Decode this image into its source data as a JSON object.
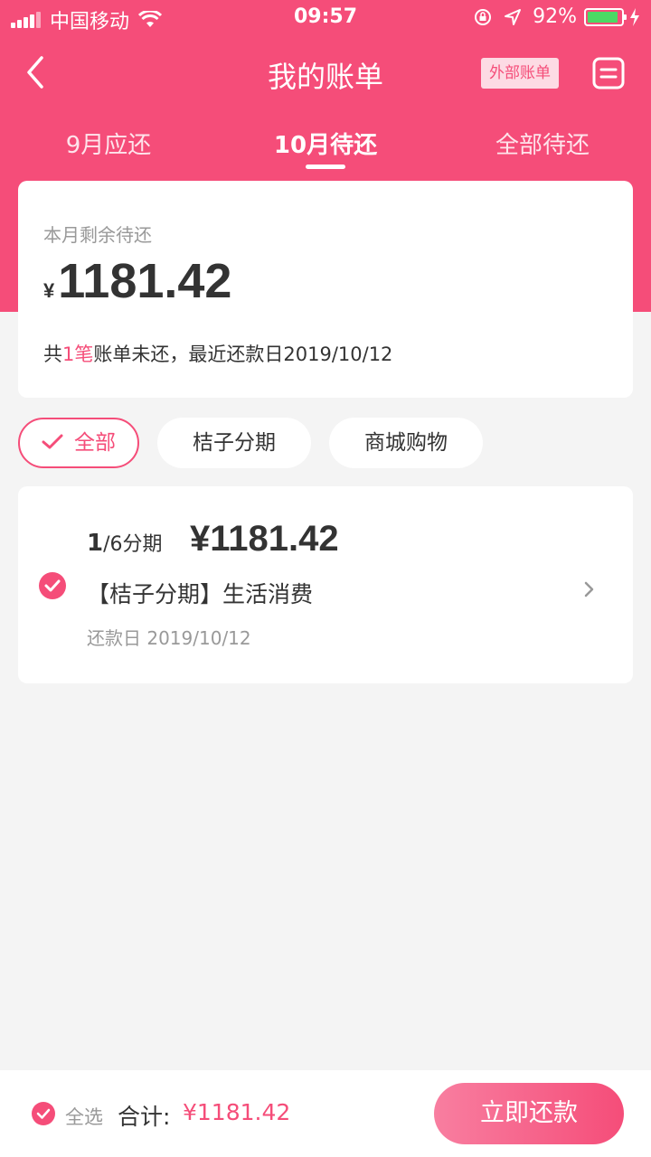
{
  "status_bar": {
    "carrier": "中国移动",
    "time": "09:57",
    "battery": "92%",
    "battery_level": 0.92
  },
  "nav": {
    "title": "我的账单",
    "external_bill": "外部账单"
  },
  "tabs": [
    {
      "label": "9月应还"
    },
    {
      "label": "10月待还"
    },
    {
      "label": "全部待还"
    }
  ],
  "summary": {
    "label": "本月剩余待还",
    "currency": "¥",
    "amount": "1181.42",
    "note_prefix": "共",
    "note_count": "1笔",
    "note_suffix": "账单未还，最近还款日2019/10/12"
  },
  "filters": [
    {
      "label": "全部"
    },
    {
      "label": "桔子分期"
    },
    {
      "label": "商城购物"
    }
  ],
  "bill": {
    "period_current": "1",
    "period_total": "/6分期",
    "amount": "¥1181.42",
    "desc": "【桔子分期】生活消费",
    "due_date": "还款日 2019/10/12"
  },
  "bottom": {
    "select_all": "全选",
    "total_label": "合计:",
    "total_value": "¥1181.42",
    "pay_button": "立即还款"
  },
  "colors": {
    "accent": "#f54d79",
    "background": "#f4f4f4"
  }
}
